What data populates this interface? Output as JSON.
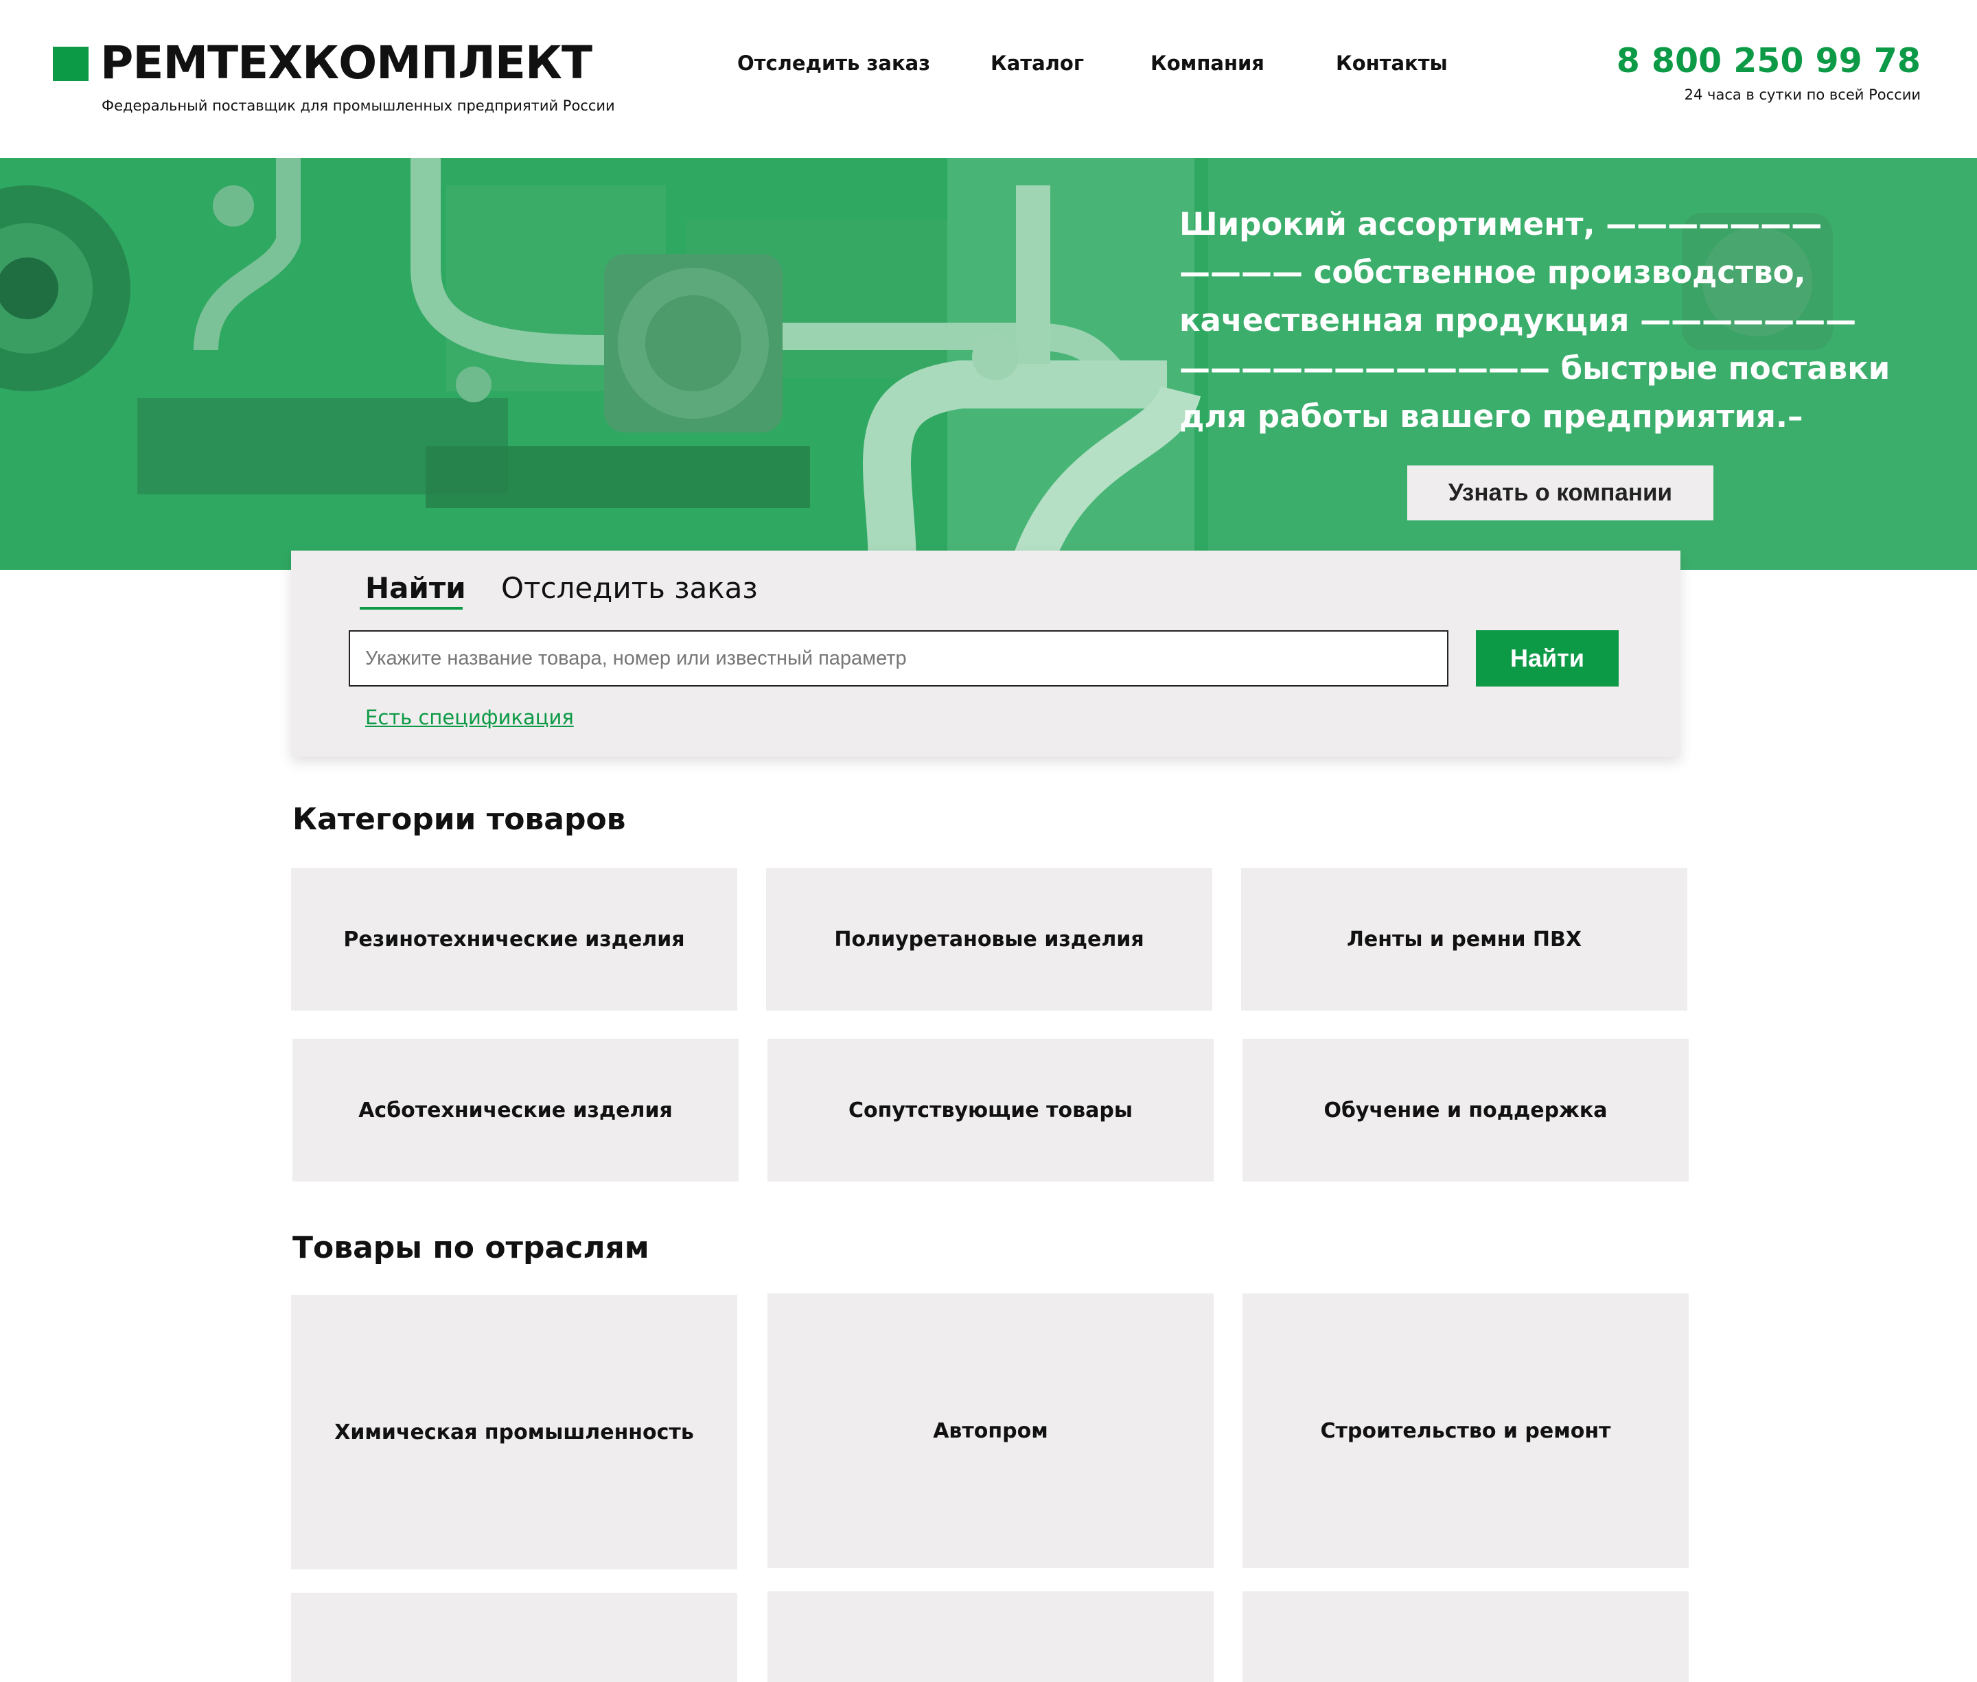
{
  "header": {
    "logo_text": "РЕМТЕХКОМПЛЕКТ",
    "logo_subtitle": "Федеральный поставщик для промышленных предприятий России",
    "nav": [
      "Отследить заказ",
      "Каталог",
      "Компания",
      "Контакты"
    ],
    "phone": "8 800 250 99 78",
    "phone_note": "24 часа в сутки по всей России"
  },
  "hero": {
    "lines": [
      "Широкий ассортимент, ———————",
      "———— собственное производство,",
      "качественная продукция ———————",
      "———————————— быстрые поставки",
      "для работы вашего предприятия.–"
    ],
    "button": "Узнать о компании"
  },
  "search": {
    "tabs": [
      "Найти",
      "Отследить заказ"
    ],
    "active_tab": "Найти",
    "placeholder": "Укажите название товара, номер или известный параметр",
    "value": "",
    "button": "Найти",
    "spec_link": "Есть спецификация"
  },
  "categories": {
    "title": "Категории товаров",
    "items": [
      "Резинотехнические изделия",
      "Полиуретановые изделия",
      "Ленты и ремни ПВХ",
      "Асботехнические изделия",
      "Сопутствующие товары",
      "Обучение и поддержка"
    ]
  },
  "industries": {
    "title": "Товары по отраслям",
    "items": [
      "Химическая промышленность",
      "Автопром",
      "Строительство и ремонт",
      "",
      "",
      ""
    ]
  },
  "colors": {
    "brand_green": "#0c9a46",
    "hero_green": "#2fa862",
    "card_bg": "#efeded"
  }
}
